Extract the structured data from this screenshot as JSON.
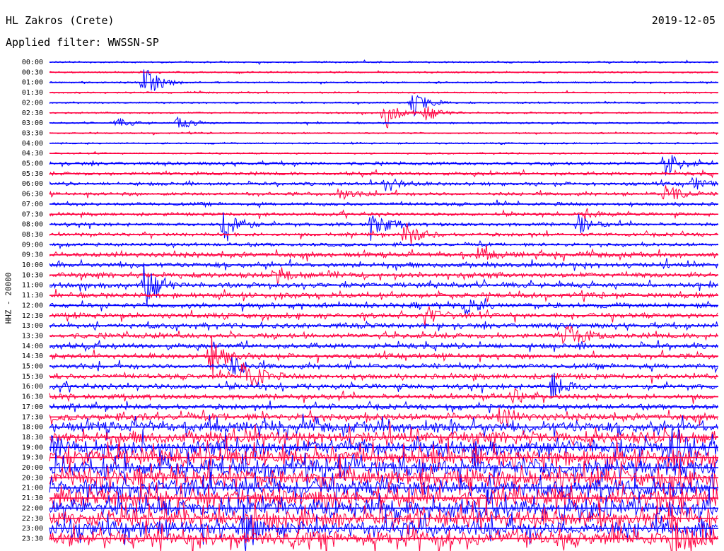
{
  "chart_data": {
    "type": "line",
    "title": "HL Zakros (Crete)",
    "date": "2019-12-05",
    "subtitle": "Applied filter: WWSSN-SP",
    "ylabel": "HHZ - 20000",
    "row_labels": [
      "00:00",
      "00:30",
      "01:00",
      "01:30",
      "02:00",
      "02:30",
      "03:00",
      "03:30",
      "04:00",
      "04:30",
      "05:00",
      "05:30",
      "06:00",
      "06:30",
      "07:00",
      "07:30",
      "08:00",
      "08:30",
      "09:00",
      "09:30",
      "10:00",
      "10:30",
      "11:00",
      "11:30",
      "12:00",
      "12:30",
      "13:00",
      "13:30",
      "14:00",
      "14:30",
      "15:00",
      "15:30",
      "16:00",
      "16:30",
      "17:00",
      "17:30",
      "18:00",
      "18:30",
      "19:00",
      "19:30",
      "20:00",
      "20:30",
      "21:00",
      "21:30",
      "22:00",
      "22:30",
      "23:00",
      "23:30"
    ],
    "trace_colors": [
      "#0000ff",
      "#ff0040"
    ],
    "noise_level": [
      1,
      1,
      1,
      1,
      1,
      1,
      1,
      1,
      1,
      1,
      2,
      2,
      2,
      2,
      2,
      2,
      2,
      2,
      2,
      3,
      3,
      3,
      3,
      3,
      3,
      3,
      3,
      3,
      3,
      3,
      3,
      3,
      3,
      3,
      3,
      4,
      6,
      7,
      8,
      9,
      9,
      9,
      9,
      9,
      9,
      9,
      8,
      8
    ],
    "events": [
      {
        "row": 2,
        "x": 0.14,
        "amplitude": 30
      },
      {
        "row": 4,
        "x": 0.54,
        "amplitude": 25
      },
      {
        "row": 5,
        "x": 0.5,
        "amplitude": 28
      },
      {
        "row": 5,
        "x": 0.56,
        "amplitude": 14
      },
      {
        "row": 6,
        "x": 0.19,
        "amplitude": 12
      },
      {
        "row": 6,
        "x": 0.1,
        "amplitude": 8
      },
      {
        "row": 12,
        "x": 0.5,
        "amplitude": 14
      },
      {
        "row": 10,
        "x": 0.92,
        "amplitude": 20
      },
      {
        "row": 13,
        "x": 0.43,
        "amplitude": 10
      },
      {
        "row": 13,
        "x": 0.92,
        "amplitude": 18
      },
      {
        "row": 12,
        "x": 0.96,
        "amplitude": 10
      },
      {
        "row": 15,
        "x": 0.8,
        "amplitude": 8
      },
      {
        "row": 16,
        "x": 0.26,
        "amplitude": 35
      },
      {
        "row": 16,
        "x": 0.48,
        "amplitude": 30
      },
      {
        "row": 16,
        "x": 0.79,
        "amplitude": 14
      },
      {
        "row": 17,
        "x": 0.53,
        "amplitude": 22
      },
      {
        "row": 19,
        "x": 0.64,
        "amplitude": 12
      },
      {
        "row": 21,
        "x": 0.34,
        "amplitude": 12
      },
      {
        "row": 22,
        "x": 0.14,
        "amplitude": 35
      },
      {
        "row": 24,
        "x": 0.62,
        "amplitude": 14
      },
      {
        "row": 25,
        "x": 0.56,
        "amplitude": 16
      },
      {
        "row": 27,
        "x": 0.77,
        "amplitude": 30
      },
      {
        "row": 29,
        "x": 0.24,
        "amplitude": 30
      },
      {
        "row": 30,
        "x": 0.27,
        "amplitude": 16
      },
      {
        "row": 31,
        "x": 0.29,
        "amplitude": 40
      },
      {
        "row": 32,
        "x": 0.75,
        "amplitude": 22
      },
      {
        "row": 33,
        "x": 0.69,
        "amplitude": 12
      },
      {
        "row": 35,
        "x": 0.67,
        "amplitude": 14
      },
      {
        "row": 38,
        "x": 0.93,
        "amplitude": 45
      },
      {
        "row": 46,
        "x": 0.29,
        "amplitude": 30
      },
      {
        "row": 47,
        "x": 0.93,
        "amplitude": 30
      }
    ]
  }
}
